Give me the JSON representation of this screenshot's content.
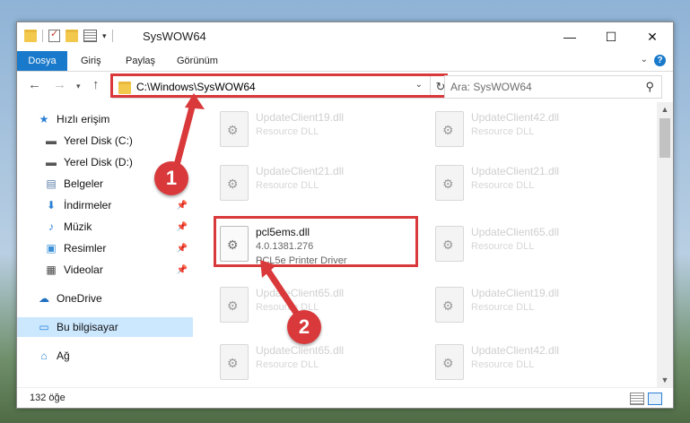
{
  "window": {
    "title": "SysWOW64",
    "controls": {
      "minimize": "—",
      "maximize": "☐",
      "close": "✕"
    }
  },
  "ribbon": {
    "tabs": [
      "Dosya",
      "Giriş",
      "Paylaş",
      "Görünüm"
    ],
    "help": "?"
  },
  "address": {
    "path": "C:\\Windows\\SysWOW64",
    "search_placeholder": "Ara: SysWOW64"
  },
  "sidebar": {
    "items": [
      {
        "label": "Hızlı erişim",
        "icon": "star-icon"
      },
      {
        "label": "Yerel Disk (C:)",
        "icon": "drive-icon"
      },
      {
        "label": "Yerel Disk (D:)",
        "icon": "drive-icon"
      },
      {
        "label": "Belgeler",
        "icon": "document-icon"
      },
      {
        "label": "İndirmeler",
        "icon": "download-icon"
      },
      {
        "label": "Müzik",
        "icon": "music-icon"
      },
      {
        "label": "Resimler",
        "icon": "picture-icon"
      },
      {
        "label": "Videolar",
        "icon": "video-icon"
      },
      {
        "label": "OneDrive",
        "icon": "cloud-icon"
      },
      {
        "label": "Bu bilgisayar",
        "icon": "computer-icon"
      },
      {
        "label": "Ağ",
        "icon": "network-icon"
      }
    ]
  },
  "files": {
    "left_col": [
      {
        "name": "UpdateClient19.dll",
        "type": "Resource DLL"
      },
      {
        "name": "UpdateClient21.dll",
        "type": "Resource DLL"
      },
      {
        "name": "pcl5ems.dll",
        "version": "4.0.1381.276",
        "type": "PCL5e Printer Driver"
      },
      {
        "name": "UpdateClient65.dll",
        "type": "Resource DLL"
      },
      {
        "name": "UpdateClient65.dll",
        "type": "Resource DLL"
      }
    ],
    "right_col": [
      {
        "name": "UpdateClient42.dll",
        "type": "Resource DLL"
      },
      {
        "name": "UpdateClient21.dll",
        "type": "Resource DLL"
      },
      {
        "name": "UpdateClient65.dll",
        "type": "Resource DLL"
      },
      {
        "name": "UpdateClient19.dll",
        "type": "Resource DLL"
      },
      {
        "name": "UpdateClient42.dll",
        "type": "Resource DLL"
      }
    ]
  },
  "status": {
    "count": "132 öğe"
  },
  "annotations": {
    "step1": "1",
    "step2": "2",
    "color": "#d9393b"
  }
}
